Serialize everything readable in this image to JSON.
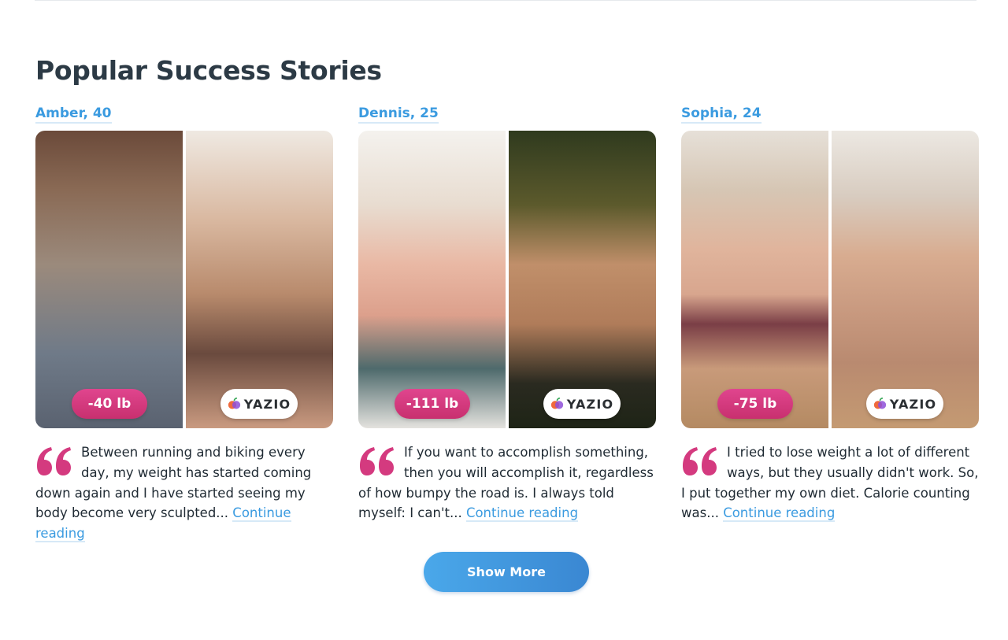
{
  "section": {
    "title": "Popular Success Stories"
  },
  "stories": [
    {
      "name": "Amber, 40",
      "badge": "-40 lb",
      "logo": "YAZIO",
      "text": "Between running and biking every day, my weight has started coming down again and I have started seeing my body become very sculpted...",
      "link": "Continue reading"
    },
    {
      "name": "Dennis, 25",
      "badge": "-111 lb",
      "logo": "YAZIO",
      "text": "If you want to accomplish something, then you will accomplish it, regardless of how bumpy the road is. I always told myself: I can't...",
      "link": "Continue reading"
    },
    {
      "name": "Sophia, 24",
      "badge": "-75 lb",
      "logo": "YAZIO",
      "text": "I tried to lose weight a lot of different ways, but they usually didn't work. So, I put together my own diet. Calorie counting was...",
      "link": "Continue reading"
    }
  ],
  "actions": {
    "show_more": "Show More"
  },
  "colors": {
    "accent": "#3b9be0",
    "badge": "#d43a7f",
    "title": "#2c3a45"
  },
  "icons": {
    "quote": "quote-icon",
    "logo": "yazio-logo-icon"
  }
}
